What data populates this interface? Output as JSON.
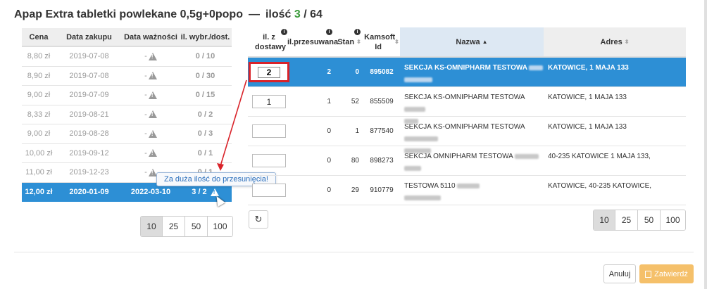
{
  "title": {
    "product": "Apap Extra tabletki powlekane 0,5g+0popo",
    "separator": "—",
    "qty_label": "ilość",
    "qty_selected": "3",
    "qty_total": "/ 64"
  },
  "left_table": {
    "headers": [
      "Cena",
      "Data zakupu",
      "Data ważności",
      "il. wybr./dost."
    ],
    "rows": [
      {
        "price": "8,80 zł",
        "date": "2019-07-08",
        "expiry": "-",
        "qty": "0 / 10"
      },
      {
        "price": "8,90 zł",
        "date": "2019-07-08",
        "expiry": "-",
        "qty": "0 / 30"
      },
      {
        "price": "9,00 zł",
        "date": "2019-07-09",
        "expiry": "-",
        "qty": "0 / 15"
      },
      {
        "price": "8,33 zł",
        "date": "2019-08-21",
        "expiry": "-",
        "qty": "0 / 2"
      },
      {
        "price": "9,00 zł",
        "date": "2019-08-28",
        "expiry": "-",
        "qty": "0 / 3"
      },
      {
        "price": "10,00 zł",
        "date": "2019-09-12",
        "expiry": "-",
        "qty": "0 / 1"
      },
      {
        "price": "11,00 zł",
        "date": "2019-12-23",
        "expiry": "-",
        "qty": "0 / 1"
      },
      {
        "price": "12,00 zł",
        "date": "2020-01-09",
        "expiry": "2022-03-10",
        "qty": "3 / 2"
      }
    ],
    "tooltip": "Za duża ilość do przesunięcia!",
    "pager": [
      "10",
      "25",
      "50",
      "100"
    ]
  },
  "right_table": {
    "headers": {
      "qty": "il. z dostawy",
      "moved": "il.przesuwana",
      "stock": "Stan",
      "kamsoft": "Kamsoft Id",
      "name": "Nazwa",
      "address": "Adres"
    },
    "rows": [
      {
        "input": "2",
        "moved": "2",
        "stock": "0",
        "id": "895082",
        "name": "SEKCJA KS-OMNIPHARM TESTOWA",
        "address": "KATOWICE, 1 MAJA 133"
      },
      {
        "input": "1",
        "moved": "1",
        "stock": "52",
        "id": "855509",
        "name": "SEKCJA KS-OMNIPHARM TESTOWA",
        "address": "KATOWICE, 1 MAJA 133"
      },
      {
        "input": "",
        "moved": "0",
        "stock": "1",
        "id": "877540",
        "name": "SEKCJA KS-OMNIPHARM TESTOWA",
        "address": "KATOWICE, 1 MAJA 133"
      },
      {
        "input": "",
        "moved": "0",
        "stock": "80",
        "id": "898273",
        "name": "SEKCJA OMNIPHARM TESTOWA",
        "address": "40-235 KATOWICE 1 MAJA 133,"
      },
      {
        "input": "",
        "moved": "0",
        "stock": "29",
        "id": "910779",
        "name": "TESTOWA 5110",
        "address": "KATOWICE, 40-235 KATOWICE,"
      }
    ],
    "pager": [
      "10",
      "25",
      "50",
      "100"
    ]
  },
  "footer": {
    "cancel": "Anuluj",
    "confirm": "Zatwierdź"
  },
  "colors": {
    "selected_row": "#2d8fd5",
    "highlight_border": "#d9232a",
    "confirm_button": "#f5c06a",
    "qty_green": "#3a9a3a"
  }
}
